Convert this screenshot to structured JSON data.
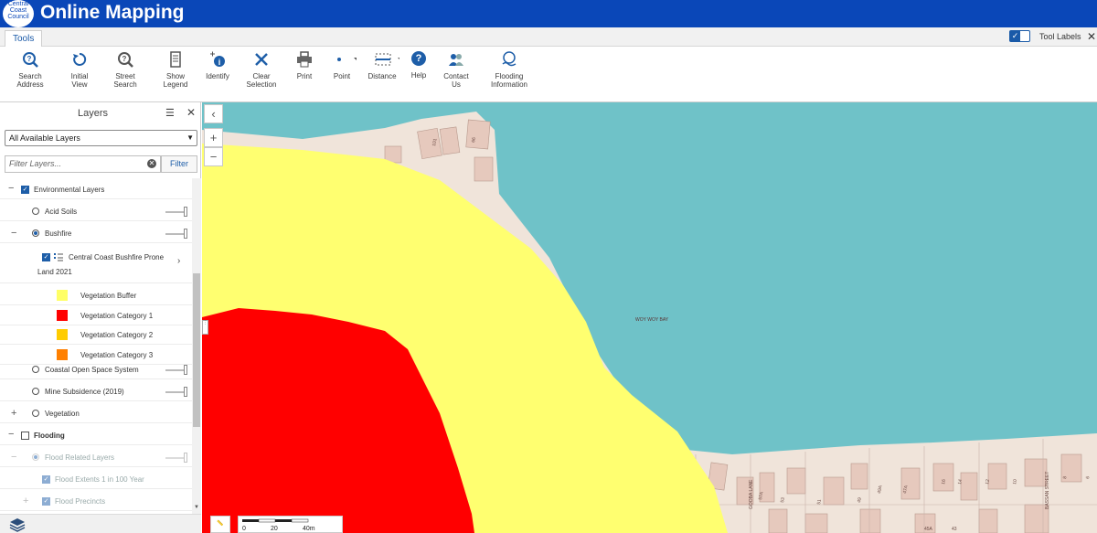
{
  "header": {
    "logo_lines": [
      "Central",
      "Coast",
      "Council"
    ],
    "title": "Online Mapping",
    "brand_color": "#0a47b8"
  },
  "tabbar": {
    "tab": "Tools",
    "tool_labels": "Tool Labels",
    "tool_labels_on": true
  },
  "toolbar": {
    "tools": [
      {
        "label": "Search Address",
        "icon": "search-address-icon"
      },
      {
        "label": "Initial View",
        "icon": "initial-view-icon"
      },
      {
        "label": "Street Search",
        "icon": "street-search-icon"
      },
      {
        "label": "Show Legend",
        "icon": "legend-icon"
      },
      {
        "label": "Identify",
        "icon": "identify-icon"
      },
      {
        "label": "Clear Selection",
        "icon": "close-icon"
      },
      {
        "label": "Print",
        "icon": "print-icon"
      },
      {
        "label": "Point",
        "icon": "point-icon"
      },
      {
        "label": "Distance",
        "icon": "distance-icon"
      },
      {
        "label": "Help",
        "icon": "help-icon"
      },
      {
        "label": "Contact Us",
        "icon": "contact-icon"
      },
      {
        "label_line1": "Flooding",
        "label_line2": "Information",
        "icon": "flooding-icon"
      }
    ]
  },
  "panel": {
    "title": "Layers",
    "select_value": "All Available Layers",
    "filter_placeholder": "Filter Layers...",
    "filter_button": "Filter",
    "layers": {
      "environmental": "Environmental Layers",
      "acid_soils": "Acid Soils",
      "bushfire": "Bushfire",
      "bushfire_sub_line1": "Central Coast Bushfire Prone",
      "bushfire_sub_line2": "Land 2021",
      "legend": [
        {
          "label": "Vegetation Buffer",
          "color": "#ffff66"
        },
        {
          "label": "Vegetation Category 1",
          "color": "#ff0000"
        },
        {
          "label": "Vegetation Category 2",
          "color": "#ffcc00"
        },
        {
          "label": "Vegetation Category 3",
          "color": "#ff8000"
        }
      ],
      "coastal": "Coastal Open Space System",
      "mine": "Mine Subsidence (2019)",
      "vegetation": "Vegetation",
      "flooding": "Flooding",
      "flood_related": "Flood Related Layers",
      "flood_extents": "Flood Extents 1 in 100 Year",
      "flood_precincts": "Flood Precincts"
    }
  },
  "map": {
    "place_label": "WOY WOY BAY",
    "water_color": "#6fc2c8",
    "land_color": "#f0e4da",
    "scale_labels": [
      "0",
      "20",
      "40m"
    ],
    "street_labels": [
      "GOOBA LANE",
      "BASSAN STREET"
    ],
    "lot_numbers": [
      "101",
      "66",
      "57A",
      "53",
      "51",
      "49",
      "49A",
      "47A",
      "16",
      "14",
      "12",
      "10",
      "8",
      "6",
      "45A",
      "43"
    ]
  }
}
